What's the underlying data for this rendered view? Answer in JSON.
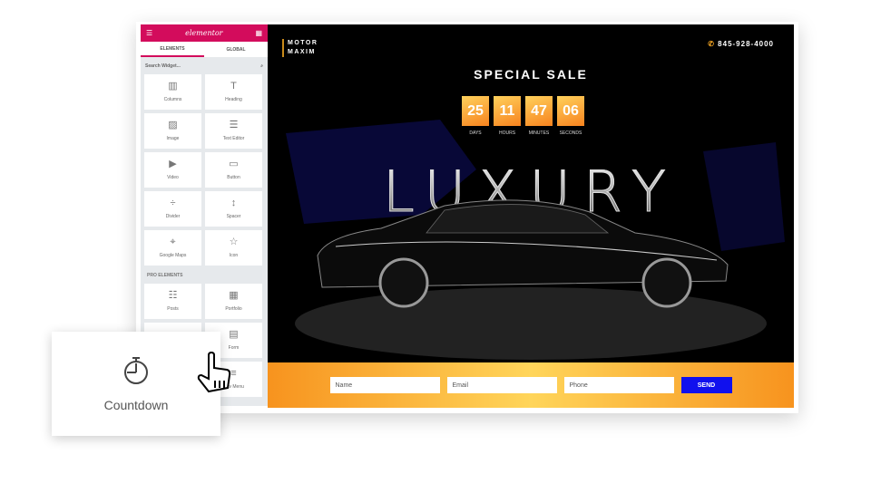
{
  "editor": {
    "logo": "elementor",
    "tabs": [
      "ELEMENTS",
      "GLOBAL"
    ],
    "search_placeholder": "Search Widget...",
    "widgets": [
      {
        "label": "Columns",
        "icon": "columns-icon",
        "glyph": "▥"
      },
      {
        "label": "Heading",
        "icon": "heading-icon",
        "glyph": "T"
      },
      {
        "label": "Image",
        "icon": "image-icon",
        "glyph": "▨"
      },
      {
        "label": "Text Editor",
        "icon": "text-editor-icon",
        "glyph": "☰"
      },
      {
        "label": "Video",
        "icon": "video-icon",
        "glyph": "▶"
      },
      {
        "label": "Button",
        "icon": "button-icon",
        "glyph": "▭"
      },
      {
        "label": "Divider",
        "icon": "divider-icon",
        "glyph": "÷"
      },
      {
        "label": "Spacer",
        "icon": "spacer-icon",
        "glyph": "↕"
      },
      {
        "label": "Google Maps",
        "icon": "map-icon",
        "glyph": "⌖"
      },
      {
        "label": "Icon",
        "icon": "star-icon",
        "glyph": "☆"
      }
    ],
    "pro_section": "PRO ELEMENTS",
    "pro_widgets": [
      {
        "label": "Posts",
        "icon": "posts-icon",
        "glyph": "☷"
      },
      {
        "label": "Portfolio",
        "icon": "portfolio-icon",
        "glyph": "▦"
      },
      {
        "label": "",
        "icon": "",
        "glyph": ""
      },
      {
        "label": "Form",
        "icon": "form-icon",
        "glyph": "▤"
      },
      {
        "label": "",
        "icon": "",
        "glyph": ""
      },
      {
        "label": "Nav Menu",
        "icon": "nav-menu-icon",
        "glyph": "≡"
      }
    ]
  },
  "site": {
    "brand_line1": "MOTOR",
    "brand_line2": "MAXIM",
    "phone": "845-928-4000",
    "title": "SPECIAL SALE",
    "countdown": [
      {
        "value": "25",
        "label": "DAYS"
      },
      {
        "value": "11",
        "label": "HOURS"
      },
      {
        "value": "47",
        "label": "MINUTES"
      },
      {
        "value": "06",
        "label": "SECONDS"
      }
    ],
    "hero_text": "LUXURY",
    "form": {
      "name": "Name",
      "email": "Email",
      "phone": "Phone",
      "send": "SEND"
    }
  },
  "drag_card": {
    "label": "Countdown",
    "icon": "stopwatch-icon"
  },
  "colors": {
    "accent": "#d30c5c",
    "countdown": "#f7931e",
    "send": "#1010ee"
  }
}
